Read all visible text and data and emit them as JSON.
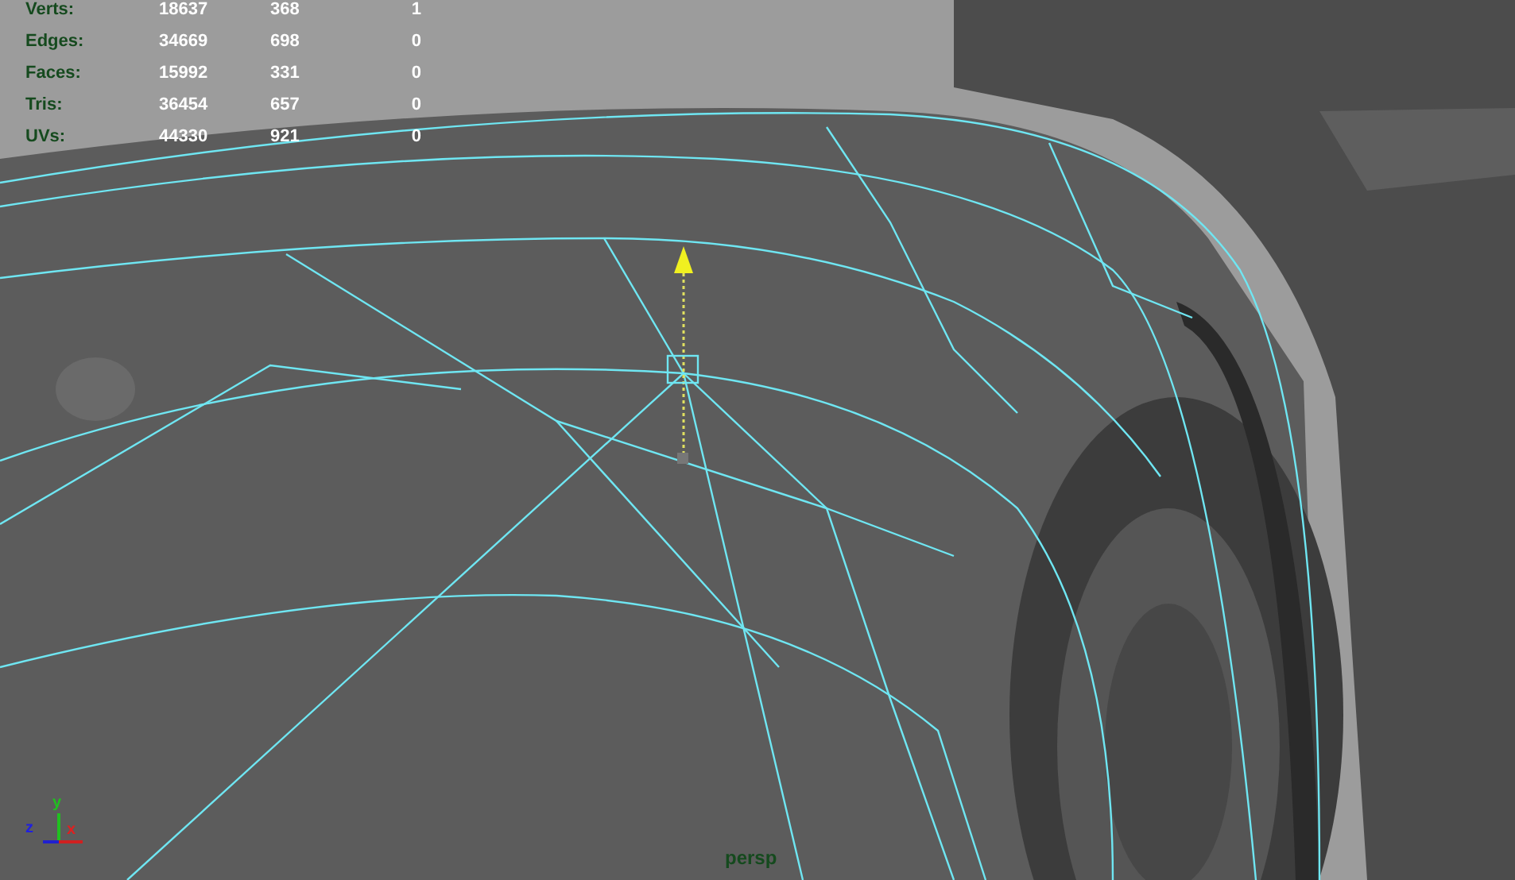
{
  "viewport": {
    "camera": "persp"
  },
  "hud_stats": [
    {
      "label": "Verts:",
      "values": [
        "18637",
        "368",
        "1"
      ]
    },
    {
      "label": "Edges:",
      "values": [
        "34669",
        "698",
        "0"
      ]
    },
    {
      "label": "Faces:",
      "values": [
        "15992",
        "331",
        "0"
      ]
    },
    {
      "label": "Tris:",
      "values": [
        "36454",
        "657",
        "0"
      ]
    },
    {
      "label": "UVs:",
      "values": [
        "44330",
        "921",
        "0"
      ]
    }
  ],
  "axis_gizmo": {
    "y": "y",
    "z": "z",
    "x": "x"
  }
}
